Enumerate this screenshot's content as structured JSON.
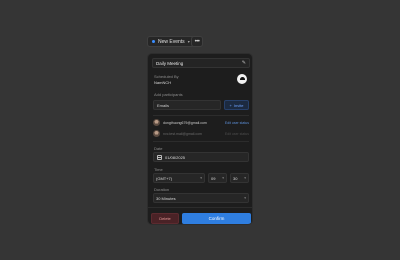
{
  "toolbar": {
    "new_events_label": "New Events",
    "more_label": "•••"
  },
  "event": {
    "title": "Daily Meeting",
    "scheduled_by_label": "Scheduled By",
    "scheduled_by_name": "NamNCH",
    "participants_label": "Add participants",
    "emails_placeholder": "Emails",
    "invite_label": "Invite",
    "participants": [
      {
        "email": "dongthuong679@gmail.com",
        "action": "Edit user status",
        "dimmed": false
      },
      {
        "email": "nvc.test.mail@gmail.com",
        "action": "Edit user status",
        "dimmed": true
      }
    ],
    "date_label": "Date",
    "date_value": "01/08/2025",
    "time_label": "Time",
    "timezone": "(GMT+7)",
    "hour": "09",
    "minute": "30",
    "duration_label": "Duration",
    "duration_value": "30 Minutes"
  },
  "footer": {
    "delete_label": "Delete",
    "confirm_label": "Confirm"
  },
  "colors": {
    "background": "#353535",
    "card": "#1d1d1d",
    "accent": "#2f7ee0",
    "danger": "#4a2226"
  },
  "icons": {
    "status_dot": "dot-icon",
    "edit": "pencil-icon",
    "calendar": "calendar-icon",
    "dropdown": "chevron-down-icon",
    "add": "plus-icon"
  }
}
